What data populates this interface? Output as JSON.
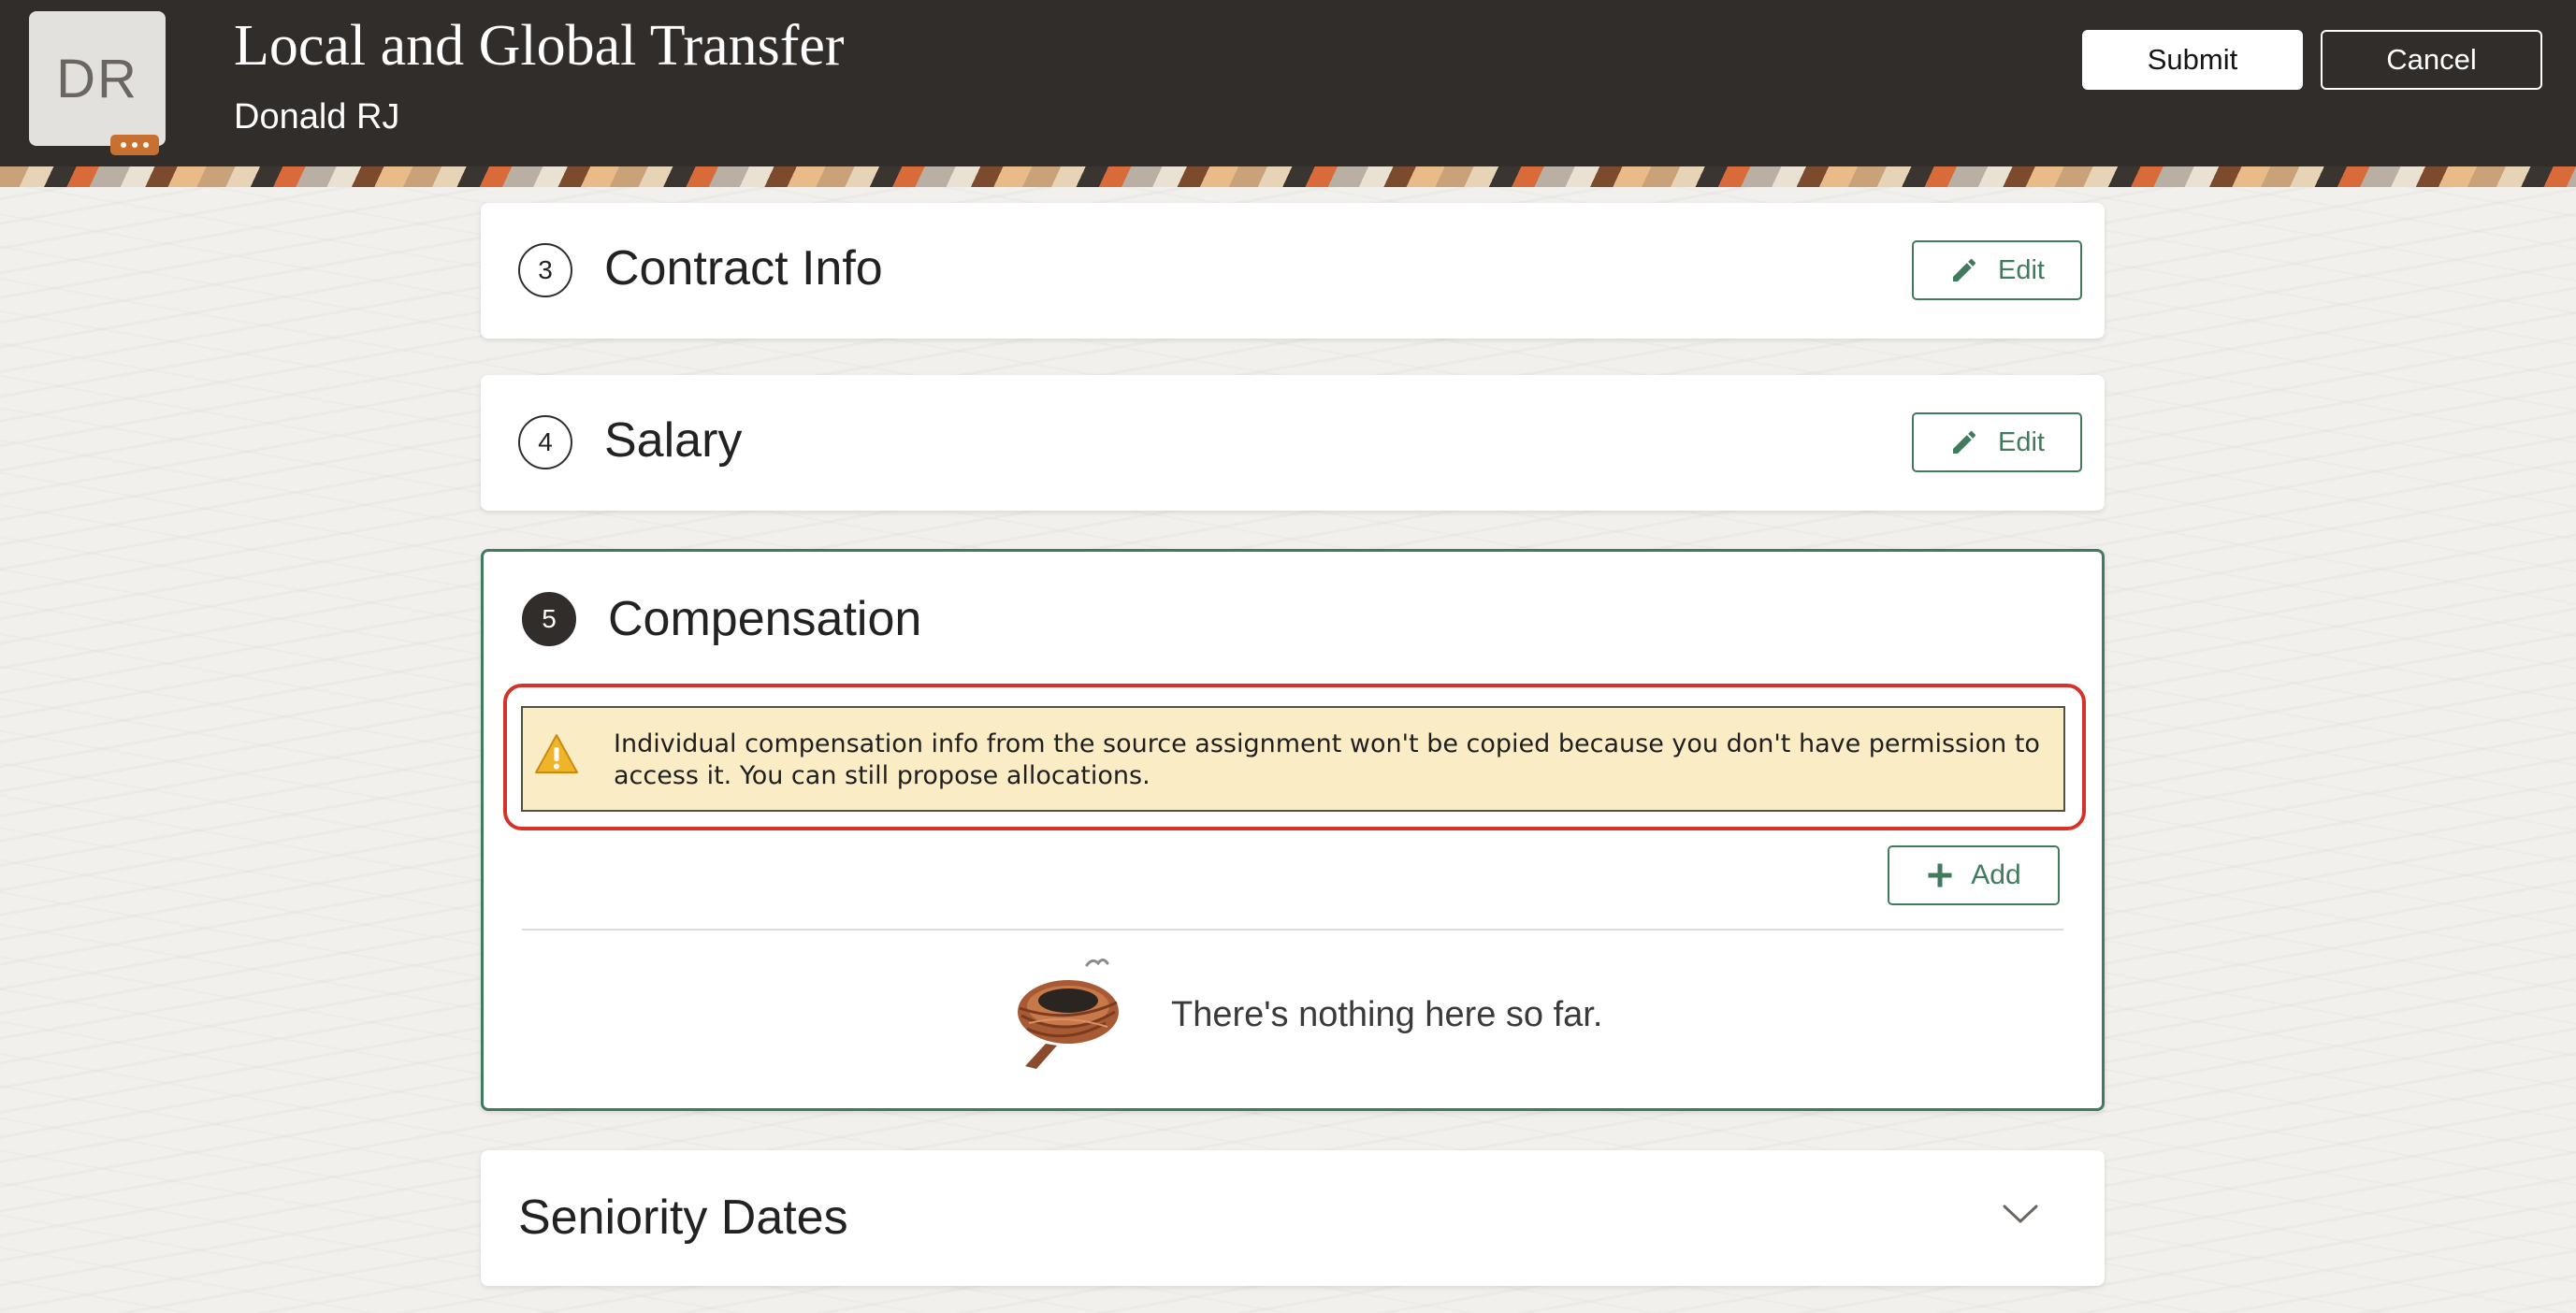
{
  "header": {
    "avatar_initials": "DR",
    "title": "Local and Global Transfer",
    "subtitle": "Donald RJ",
    "submit_label": "Submit",
    "cancel_label": "Cancel"
  },
  "sections": [
    {
      "number": "3",
      "title": "Contract Info",
      "edit_label": "Edit"
    },
    {
      "number": "4",
      "title": "Salary",
      "edit_label": "Edit"
    },
    {
      "number": "5",
      "title": "Compensation"
    }
  ],
  "compensation": {
    "warning_text": "Individual compensation info from the source assignment won't be copied because you don't have permission to access it. You can still propose allocations.",
    "add_label": "Add",
    "empty_message": "There's nothing here so far."
  },
  "seniority": {
    "title": "Seniority Dates"
  },
  "colors": {
    "header_bg": "#312d2a",
    "accent_green": "#3f7b5c",
    "warning_bg": "#faedc6",
    "highlight_red": "#d7322a"
  },
  "icons": [
    "more-options-icon",
    "pencil-icon",
    "warning-icon",
    "plus-icon",
    "empty-nest-illustration",
    "chevron-down-icon"
  ]
}
